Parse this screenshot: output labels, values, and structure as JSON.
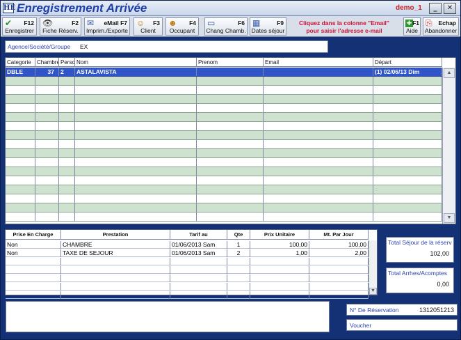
{
  "window": {
    "logo": "HE",
    "title": "Enregistrement Arrivée",
    "user": "demo_1",
    "minimize": "_",
    "close": "✕"
  },
  "toolbar": {
    "buttons": [
      {
        "key": "F12",
        "label": "Enregistrer",
        "icon": "✔"
      },
      {
        "key": "F2",
        "label": "Fiche  Réserv.",
        "icon": "👁"
      },
      {
        "key": "eMail  F7",
        "label": "Imprim./Exporte",
        "icon": "✉"
      },
      {
        "key": "F3",
        "label": "Client",
        "icon": "☺"
      },
      {
        "key": "F4",
        "label": "Occupant",
        "icon": "☻"
      },
      {
        "key": "F6",
        "label": "Chang Chamb.",
        "icon": "▭"
      },
      {
        "key": "F9",
        "label": "Dates séjour",
        "icon": "▦"
      },
      {
        "key": "F1",
        "label": "Aide",
        "icon": "✚"
      },
      {
        "key": "Echap",
        "label": "Abandonner",
        "icon": "⎘"
      }
    ],
    "hint_line1": "Cliquez dans la colonne \"Email\"",
    "hint_line2": "pour saisir l'adresse e-mail"
  },
  "agency": {
    "label": "Agence/Société/Groupe",
    "value": "EX"
  },
  "grid": {
    "headers": [
      "Categorie",
      "Chambre",
      "Perso",
      "Nom",
      "Prenom",
      "Email",
      "Départ"
    ],
    "rows": [
      {
        "categorie": "DBLE",
        "chambre": "37",
        "perso": "2",
        "nom": "ASTALAVISTA",
        "prenom": "",
        "email": "",
        "depart": "(1) 02/06/13 Dim"
      }
    ]
  },
  "prestations": {
    "headers": [
      "Prise En Charge",
      "Prestation",
      "Tarif au",
      "Qte",
      "Prix Unitaire",
      "Mt. Par Jour"
    ],
    "rows": [
      {
        "prise": "Non",
        "prestation": "CHAMBRE",
        "tarif": "01/06/2013  Sam",
        "qte": "1",
        "prix": "100,00",
        "mt": "100,00"
      },
      {
        "prise": "Non",
        "prestation": "TAXE DE SEJOUR",
        "tarif": "01/06/2013  Sam",
        "qte": "2",
        "prix": "1,00",
        "mt": "2,00"
      }
    ]
  },
  "totals": {
    "sejour_label": "Total Séjour de la réserv",
    "sejour_value": "102,00",
    "arrhes_label": "Total Arrhes/Acomptes",
    "arrhes_value": "0,00"
  },
  "reservation": {
    "label": "N° De Réservation",
    "value": "1312051213"
  },
  "voucher": {
    "label": "Voucher"
  }
}
